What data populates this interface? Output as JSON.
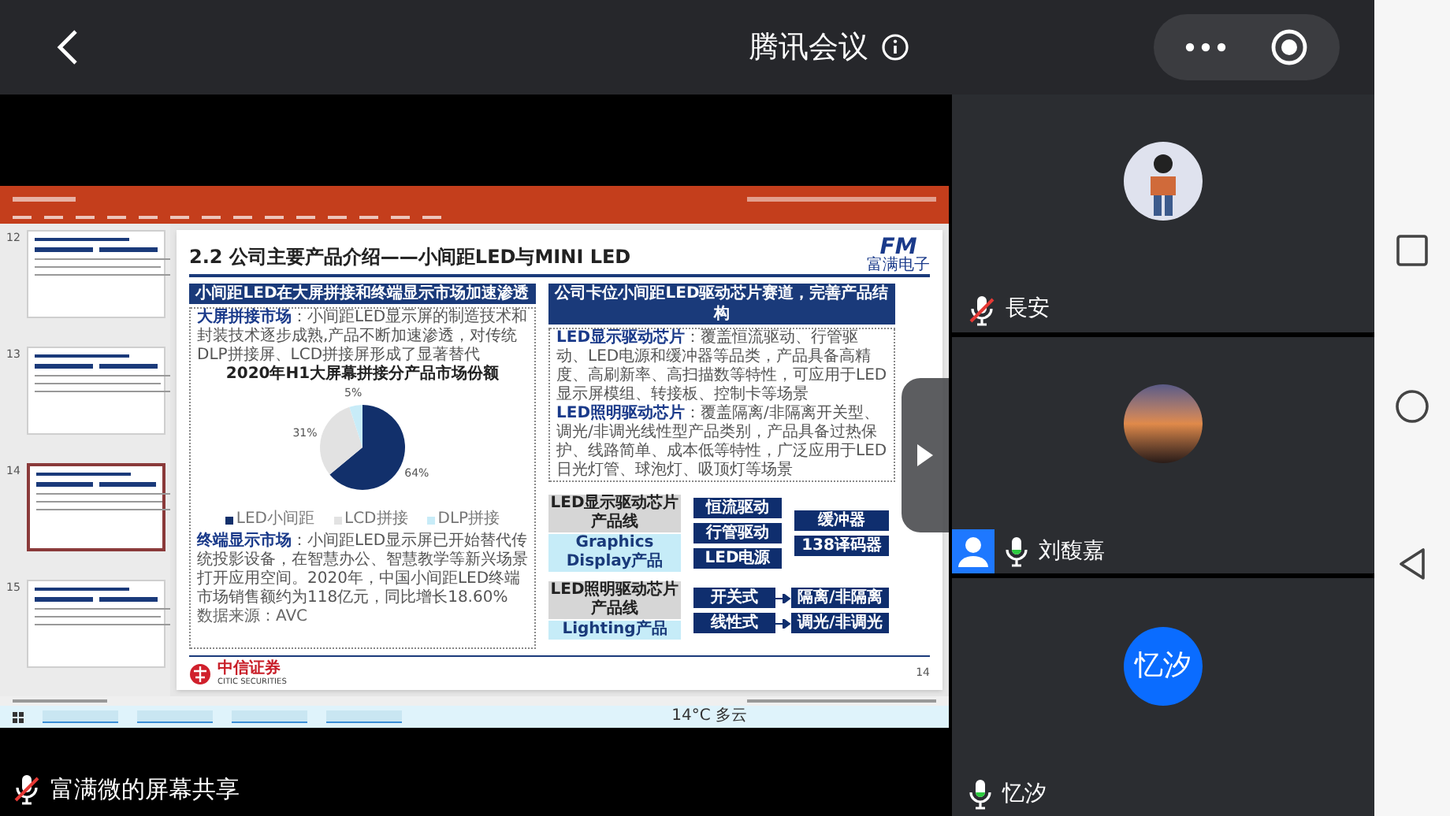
{
  "header": {
    "title": "腾讯会议"
  },
  "shared_screen": {
    "thumbnails": [
      {
        "number": "12",
        "selected": false
      },
      {
        "number": "13",
        "selected": false
      },
      {
        "number": "14",
        "selected": true
      },
      {
        "number": "15",
        "selected": false
      }
    ],
    "slide": {
      "title": "2.2 公司主要产品介绍——小间距LED与MINI LED",
      "logo_mark": "FM",
      "logo_text": "富满电子",
      "left_heading": "小间距LED在大屏拼接和终端显示市场加速渗透",
      "left_points": [
        "**大屏拼接市场**：小间距LED显示屏的制造技术和封装技术逐步成熟,产品不断加速渗透，对传统DLP拼接屏、LCD拼接屏形成了显著替代",
        "**终端显示市场**：小间距LED显示屏已开始替代传统投影设备，在智慧办公、智慧教学等新兴场景打开应用空间。2020年，中国小间距LED终端市场销售额约为118亿元，同比增长18.60%"
      ],
      "chart_data": {
        "type": "pie",
        "title": "2020年H1大屏幕拼接分产品市场份额",
        "categories": [
          "LED小间距",
          "LCD拼接",
          "DLP拼接"
        ],
        "values": [
          64,
          31,
          5
        ],
        "colors": [
          "#12306b",
          "#e2e2e2",
          "#c8ecf8"
        ],
        "value_labels": [
          "64%",
          "31%",
          "5%"
        ],
        "legend": "bottom"
      },
      "source": "数据来源：AVC",
      "right_heading": "公司卡位小间距LED驱动芯片赛道，完善产品结构",
      "right_points": [
        "**LED显示驱动芯片**：覆盖恒流驱动、行管驱动、LED电源和缓冲器等品类，产品具备高精度、高刷新率、高扫描数等特性，可应用于LED显示屏模组、转接板、控制卡等场景",
        "**LED照明驱动芯片**：覆盖隔离/非隔离开关型、调光/非调光线性型产品类别，产品具备过热保护、线路简单、成本低等特性，广泛应用于LED日光灯管、球泡灯、吸顶灯等场景"
      ],
      "product_lines": [
        {
          "kind": "display",
          "name": "LED显示驱动芯片产品线",
          "subtitle": "Graphics Display产品",
          "chips": [
            "恒流驱动",
            "行管驱动",
            "LED电源"
          ],
          "extras": [
            "缓冲器",
            "138译码器"
          ]
        },
        {
          "kind": "lighting",
          "name": "LED照明驱动芯片产品线",
          "subtitle": "Lighting产品",
          "chips": [
            "开关式",
            "线性式"
          ],
          "extras": [
            "隔离/非隔离",
            "调光/非调光"
          ]
        }
      ],
      "footer_logo": "中信证券",
      "footer_sub": "CITIC SECURITIES",
      "page": "14"
    },
    "taskbar": {
      "weather": "14°C 多云"
    }
  },
  "sharer": {
    "label": "富满微的屏幕共享",
    "muted": true
  },
  "participants": [
    {
      "name": "長安",
      "muted": true,
      "avatar": {
        "kind": "drawing"
      },
      "person_badge": false
    },
    {
      "name": "刘馥嘉",
      "muted": false,
      "avatar": {
        "kind": "photo"
      },
      "person_badge": true
    },
    {
      "name": "忆汐",
      "muted": false,
      "avatar": {
        "kind": "initials",
        "text": "忆汐"
      },
      "person_badge": false
    }
  ]
}
